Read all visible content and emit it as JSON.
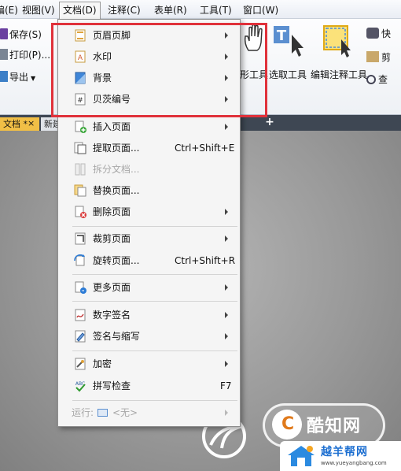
{
  "menubar": {
    "edit_partial": "编(E)",
    "view": "视图(V)",
    "document": "文档(D)",
    "comment": "注释(C)",
    "form": "表单(R)",
    "tools": "工具(T)",
    "window": "窗口(W)"
  },
  "ribbon": {
    "save": "保存(S)",
    "print": "打印(P)...",
    "export": "导出",
    "shape_tool_partial": "形工具",
    "select_tool": "选取工具",
    "edit_annot_tool": "编辑注释工具",
    "right_1": "快",
    "right_2": "剪",
    "right_3": "查"
  },
  "tabs": {
    "active": "文档 *",
    "close": "×",
    "inactive": "新建",
    "add": "+"
  },
  "menu": {
    "header_footer": "页眉页脚",
    "watermark": "水印",
    "background": "背景",
    "bates": "贝茨编号",
    "insert_page": "插入页面",
    "extract_page": "提取页面...",
    "extract_shortcut": "Ctrl+Shift+E",
    "split_doc": "拆分文档...",
    "replace_page": "替换页面...",
    "delete_page": "删除页面",
    "crop_page": "裁剪页面",
    "rotate_page": "旋转页面...",
    "rotate_shortcut": "Ctrl+Shift+R",
    "more_pages": "更多页面",
    "digital_sign": "数字签名",
    "sign_initials": "签名与缩写",
    "encrypt": "加密",
    "spell_check": "拼写检查",
    "spell_shortcut": "F7",
    "run_label": "运行:",
    "run_value": "<无>"
  },
  "watermark": {
    "badge_char": "C",
    "badge_text": "酷知网",
    "site_title": "越羊帮网",
    "site_url": "www.yueyangbang.com"
  },
  "colors": {
    "highlight": "#e0313a",
    "active_tab": "#f1bf46",
    "tab_bar": "#3e4753"
  }
}
